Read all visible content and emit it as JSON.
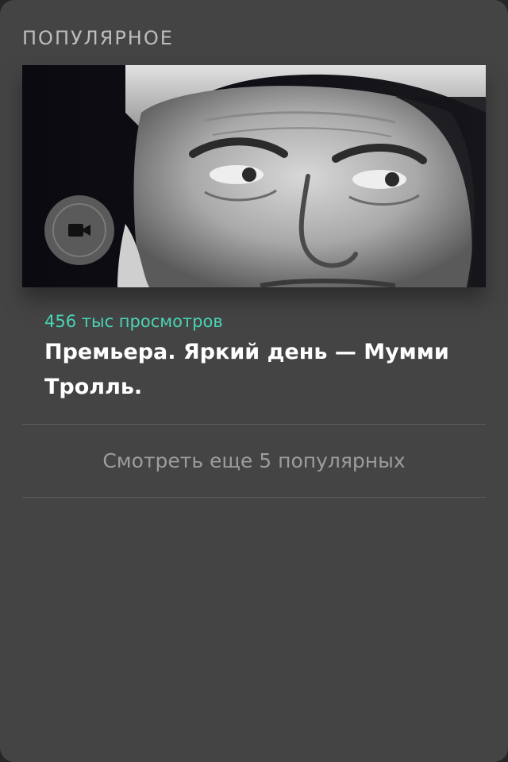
{
  "section": {
    "title": "ПОПУЛЯРНОЕ"
  },
  "featured": {
    "views": "456 тыс просмотров",
    "headline": "Премьера. Яркий день — Мумми Тролль.",
    "badge_icon": "video-camera-icon",
    "thumbnail": "portrait-photo"
  },
  "more": {
    "label": "Смотреть еще 5 популярных"
  },
  "colors": {
    "card_bg": "#444444",
    "accent": "#49d4b4",
    "title": "#bdbdbd",
    "headline": "#ffffff",
    "more_link": "#9d9d9d"
  }
}
